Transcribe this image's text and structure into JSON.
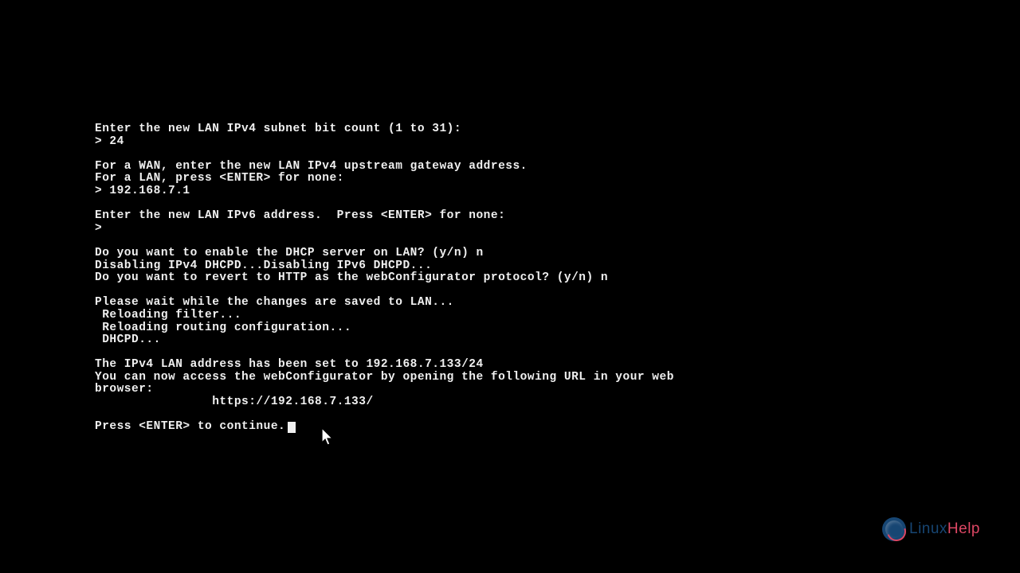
{
  "terminal": {
    "lines": [
      "Enter the new LAN IPv4 subnet bit count (1 to 31):",
      "> 24",
      "",
      "For a WAN, enter the new LAN IPv4 upstream gateway address.",
      "For a LAN, press <ENTER> for none:",
      "> 192.168.7.1",
      "",
      "Enter the new LAN IPv6 address.  Press <ENTER> for none:",
      ">",
      "",
      "Do you want to enable the DHCP server on LAN? (y/n) n",
      "Disabling IPv4 DHCPD...Disabling IPv6 DHCPD...",
      "Do you want to revert to HTTP as the webConfigurator protocol? (y/n) n",
      "",
      "Please wait while the changes are saved to LAN...",
      " Reloading filter...",
      " Reloading routing configuration...",
      " DHCPD...",
      "",
      "The IPv4 LAN address has been set to 192.168.7.133/24",
      "You can now access the webConfigurator by opening the following URL in your web",
      "browser:",
      "                https://192.168.7.133/",
      ""
    ],
    "prompt_line": "Press <ENTER> to continue."
  },
  "watermark": {
    "text_left": "Linux",
    "text_right": "Help"
  }
}
